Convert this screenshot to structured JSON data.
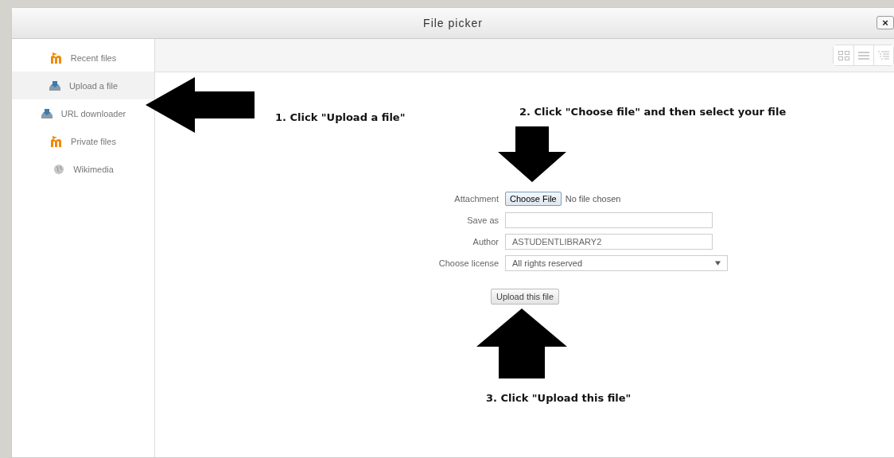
{
  "window": {
    "title": "File picker",
    "close_label": "×"
  },
  "sidebar": {
    "items": [
      {
        "label": "Recent files",
        "kind": "moodle",
        "selected": false
      },
      {
        "label": "Upload a file",
        "kind": "upload",
        "selected": true
      },
      {
        "label": "URL downloader",
        "kind": "upload",
        "selected": false
      },
      {
        "label": "Private files",
        "kind": "moodle",
        "selected": false
      },
      {
        "label": "Wikimedia",
        "kind": "globe",
        "selected": false
      }
    ]
  },
  "view_buttons": [
    {
      "kind": "icons",
      "selected": false
    },
    {
      "kind": "list",
      "selected": false
    },
    {
      "kind": "tree",
      "selected": false
    }
  ],
  "form": {
    "attachment_label": "Attachment",
    "choose_button": "Choose File",
    "no_file": "No file chosen",
    "save_as_label": "Save as",
    "author_label": "Author",
    "author_value": "ASTUDENTLIBRARY2",
    "license_label": "Choose license",
    "license_value": "All rights reserved",
    "upload_button": "Upload this file"
  },
  "annotations": [
    {
      "text": "1. Click \"Upload a file\"",
      "kind": "left"
    },
    {
      "text": "2. Click \"Choose file\" and then select your file",
      "kind": "down"
    },
    {
      "text": "3. Click \"Upload this file\"",
      "kind": "up"
    }
  ]
}
